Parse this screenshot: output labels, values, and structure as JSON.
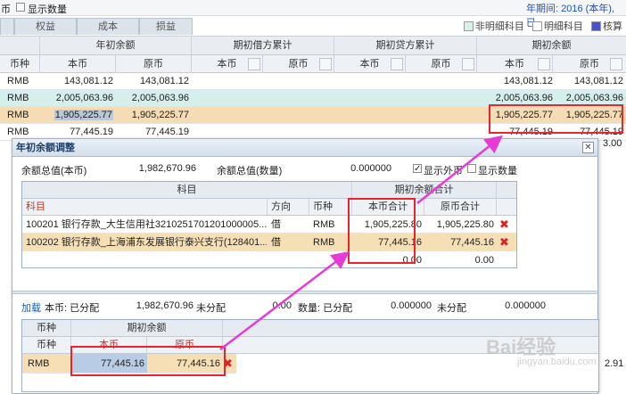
{
  "top": {
    "left_cut": "币",
    "show_qty": "显示数量",
    "period": "年期间: 2016 (本年), 已"
  },
  "tabs": [
    "",
    "权益",
    "成本",
    "损益"
  ],
  "legend": [
    {
      "label": "非明细科目",
      "color": "#d6f0ee"
    },
    {
      "label": "明细科目",
      "color": "#ffffff"
    },
    {
      "label": "核算",
      "color": "#4a4fd0"
    }
  ],
  "grid": {
    "groups": [
      "年初余额",
      "期初借方累计",
      "期初贷方累计",
      "期初余额"
    ],
    "sub": [
      "币种",
      "本币",
      "原币",
      "本币",
      "原币",
      "本币",
      "原币",
      "本币",
      "原币"
    ],
    "rows": [
      {
        "cur": "RMB",
        "a": "143,081.12",
        "b": "143,081.12",
        "c": "143,081.12",
        "d": "143,081.12",
        "color": "#ffffff"
      },
      {
        "cur": "RMB",
        "a": "2,005,063.96",
        "b": "2,005,063.96",
        "c": "2,005,063.96",
        "d": "2,005,063.96",
        "color": "#d5efed"
      },
      {
        "cur": "RMB",
        "a": "1,905,225.77",
        "b": "1,905,225.77",
        "c": "1,905,225.77",
        "d": "1,905,225.77",
        "color": "#f5dcb4"
      },
      {
        "cur": "RMB",
        "a": "77,445.19",
        "b": "77,445.19",
        "c": "77,445.19",
        "d": "77,445.19",
        "color": "#ffffff"
      }
    ],
    "right_cut": "3.00",
    "bottom_right": "2.91"
  },
  "dialog": {
    "title": "年初余额调整",
    "close": "✕",
    "total_label": "余额总值(本币)",
    "total_value": "1,982,670.96",
    "qty_label": "余额总值(数量)",
    "qty_value": "0.000000",
    "show_fc": "显示外币",
    "show_qty": "显示数量",
    "tbl_head": {
      "subject_group": "科目",
      "subject": "科目",
      "dir": "方向",
      "cur": "币种",
      "period_group": "期初余额合计",
      "local": "本币合计",
      "orig": "原币合计"
    },
    "rows": [
      {
        "subject": "100201 银行存款_大生信用社3210251701201000005...",
        "dir": "借",
        "cur": "RMB",
        "local": "1,905,225.80",
        "orig": "1,905,225.80"
      },
      {
        "subject": "100202 银行存款_上海浦东发展银行泰兴支行(128401...",
        "dir": "借",
        "cur": "RMB",
        "local": "77,445.16",
        "orig": "77,445.16"
      }
    ],
    "sum_local": "0.00",
    "sum_orig": "0.00",
    "load": "加载",
    "local_alloc": "本币: 已分配",
    "local_alloc_val": "1,982,670.96",
    "unalloc": "未分配",
    "unalloc_val": "0.00",
    "qty_alloc": "数量: 已分配",
    "qty_alloc_val": "0.000000",
    "qty_unalloc": "未分配",
    "qty_unalloc_val": "0.000000",
    "ltbl": {
      "cur_group": "币种",
      "bal_group": "期初余额",
      "cur": "币种",
      "local": "本币",
      "orig": "原币"
    },
    "lrow": {
      "cur": "RMB",
      "local": "77,445.16",
      "orig": "77,445.16"
    }
  },
  "watermark": {
    "brand": "Bai经验",
    "url": "jingyan.baidu.com"
  }
}
